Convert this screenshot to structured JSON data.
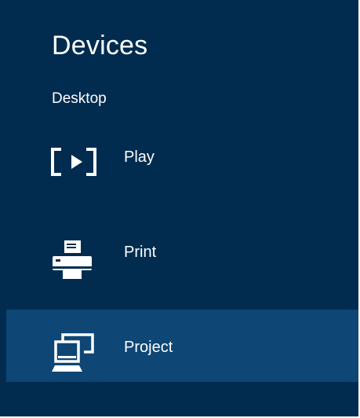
{
  "pane": {
    "title": "Devices",
    "section_label": "Desktop",
    "background_color": "#012c4f",
    "selected_background_color": "#0e4675"
  },
  "devices": [
    {
      "label": "Play",
      "icon": "play-screen-icon",
      "selected": false
    },
    {
      "label": "Print",
      "icon": "printer-icon",
      "selected": false
    },
    {
      "label": "Project",
      "icon": "project-display-icon",
      "selected": true
    }
  ]
}
